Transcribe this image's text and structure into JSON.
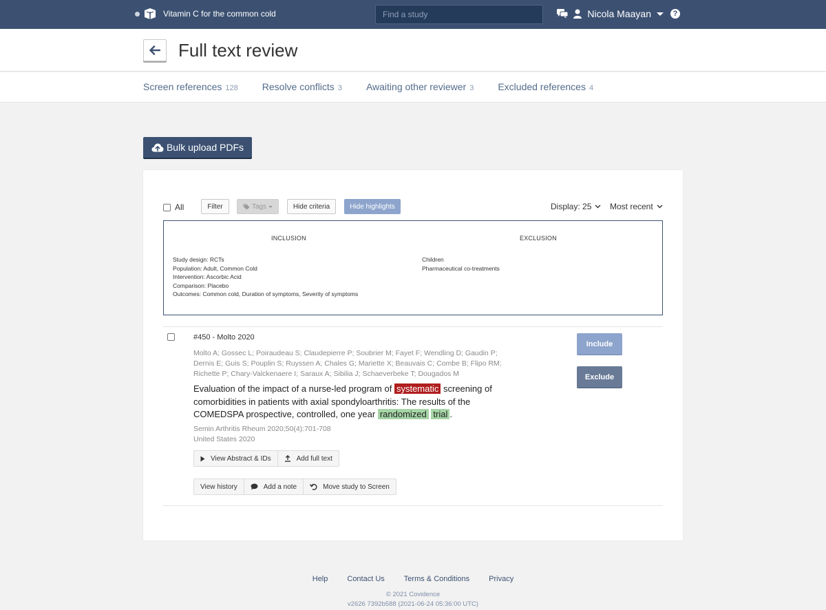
{
  "header": {
    "project_name": "Vitamin C for the common cold",
    "search_placeholder": "Find a study",
    "user_name": "Nicola Maayan",
    "help_symbol": "?",
    "colors": {
      "bar": "#3c5172",
      "accent": "#8da4cc"
    }
  },
  "page": {
    "title": "Full text review"
  },
  "tabs": [
    {
      "label": "Screen references",
      "count": "128"
    },
    {
      "label": "Resolve conflicts",
      "count": "3"
    },
    {
      "label": "Awaiting other reviewer",
      "count": "3"
    },
    {
      "label": "Excluded references",
      "count": "4"
    }
  ],
  "bulk_upload_label": "Bulk upload PDFs",
  "toolbar": {
    "all_label": "All",
    "filter_label": "Filter",
    "tags_label": "Tags",
    "hide_criteria_label": "Hide criteria",
    "hide_highlights_label": "Hide highlights",
    "display_label": "Display: 25",
    "sort_label": "Most recent"
  },
  "criteria": {
    "inclusion_heading": "INCLUSION",
    "exclusion_heading": "EXCLUSION",
    "inclusion": [
      "Study design: RCTs",
      "Population: Adult, Common Cold",
      "Intervention: Ascorbic Acid",
      "Comparison: Placebo",
      "Outcomes: Common cold, Duration of symptoms, Severity of symptoms"
    ],
    "exclusion": [
      "Children",
      "Pharmaceutical co-treatments"
    ]
  },
  "reference": {
    "id_line": "#450 - Molto 2020",
    "authors": "Molto A; Gossec L; Poiraudeau S; Claudepierre P; Soubrier M; Fayet F; Wendling D; Gaudin P; Dernis E; Guis S; Pouplin S; Ruyssen A; Chales G; Mariette X; Beauvais C; Combe B; Flipo RM; Richette P; Chary-Valckenaere I; Saraux A; Sibilia J; Schaeverbeke T; Dougados M",
    "title_part1": "Evaluation of the impact of a nurse-led program of",
    "highlight_red": "systematic",
    "title_part2": "screening of comorbidities in patients with axial spondyloarthritis: The results of the COMEDSPA prospective, controlled, one year",
    "highlight_green_1": "randomized",
    "highlight_green_2": "trial",
    "title_end": ".",
    "journal": "Semin Arthritis Rheum 2020;50(4):701-708",
    "country": "United States 2020",
    "view_abstract_label": "View Abstract & IDs",
    "add_full_text_label": "Add full text",
    "view_history_label": "View history",
    "add_note_label": "Add a note",
    "move_study_label": "Move study to Screen",
    "include_label": "Include",
    "exclude_label": "Exclude",
    "highlight_colors": {
      "negative": "#b01e1e",
      "positive": "#a6d5a6"
    }
  },
  "footer": {
    "links": [
      "Help",
      "Contact Us",
      "Terms & Conditions",
      "Privacy"
    ],
    "copyright": "© 2021 Covidence",
    "version": "v2626 7392b588 (2021-06-24 05:36:00 UTC)"
  }
}
